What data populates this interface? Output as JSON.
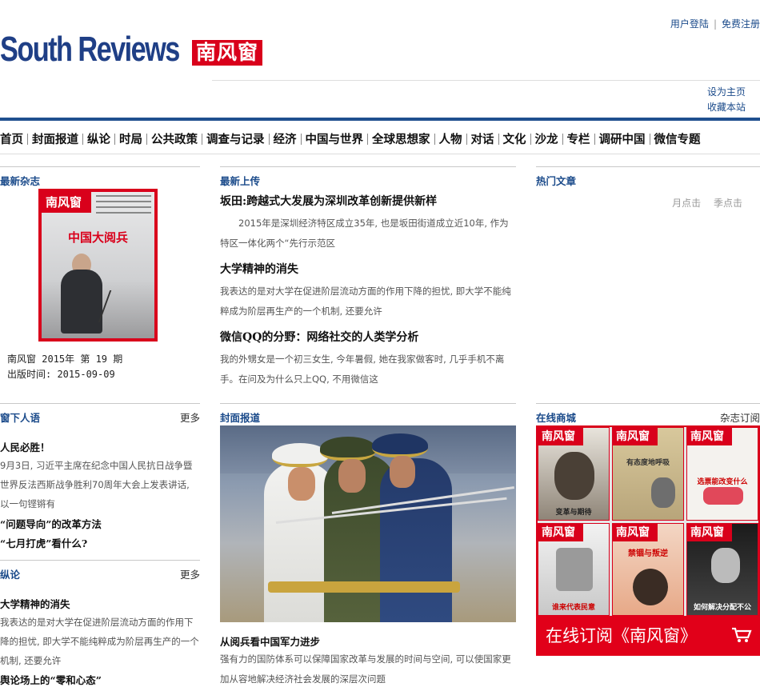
{
  "header": {
    "logo_en": "South Reviews",
    "logo_cn": "南风窗",
    "login": "用户登陆",
    "register": "免费注册",
    "set_home": "设为主页",
    "bookmark": "收藏本站"
  },
  "nav": [
    "首页",
    "封面报道",
    "纵论",
    "时局",
    "公共政策",
    "调查与记录",
    "经济",
    "中国与世界",
    "全球思想家",
    "人物",
    "对话",
    "文化",
    "沙龙",
    "专栏",
    "调研中国",
    "微信专题"
  ],
  "latest_magazine": {
    "title": "最新杂志",
    "cover_brand": "南风窗",
    "cover_headline": "中国大阅兵",
    "issue": "南风窗 2015年 第 19 期",
    "date": "出版时间: 2015-09-09"
  },
  "latest_upload": {
    "title": "最新上传",
    "articles": [
      {
        "title": "坂田:跨越式大发展为深圳改革创新提供新样",
        "summary": "　　2015年是深圳经济特区成立35年, 也是坂田街道成立近10年, 作为特区一体化两个“先行示范区"
      },
      {
        "title": "大学精神的消失",
        "summary": "我表达的是对大学在促进阶层流动方面的作用下降的担忧, 即大学不能纯粹成为阶层再生产的一个机制, 还要允许"
      },
      {
        "title": "微信QQ的分野：网络社交的人类学分析",
        "summary": "我的外甥女是一个初三女生, 今年暑假, 她在我家做客时, 几乎手机不离手。在问及为什么只上QQ, 不用微信这"
      }
    ]
  },
  "hot": {
    "title": "热门文章",
    "tab_month": "月点击",
    "tab_season": "季点击"
  },
  "window": {
    "title": "窗下人语",
    "more": "更多",
    "item1_title": "人民必胜！",
    "item1_text": "9月3日, 习近平主席在纪念中国人民抗日战争暨世界反法西斯战争胜利70周年大会上发表讲话, 以一句铿锵有",
    "item2_title": "“问题导向”的改革方法",
    "item3_title": "“七月打虎”看什么?"
  },
  "zonglun": {
    "title": "纵论",
    "more": "更多",
    "item1_title": "大学精神的消失",
    "item1_text": "我表达的是对大学在促进阶层流动方面的作用下降的担忧, 即大学不能纯粹成为阶层再生产的一个机制, 还要允许",
    "item2_title": "舆论场上的“零和心态”"
  },
  "cover_story": {
    "title": "封面报道",
    "headline": "从阅兵看中国军力进步",
    "summary": "强有力的国防体系可以保障国家改革与发展的时间与空间, 可以使国家更加从容地解决经济社会发展的深层次问题"
  },
  "shop": {
    "title": "在线商城",
    "subscribe": "杂志订阅",
    "banner": "在线订阅《南风窗》",
    "mag_brand": "南风窗",
    "covers": [
      "变革与期待",
      "有态度地呼吸",
      "选票能改变什么",
      "谁来代表民意",
      "禁锢与叛逆",
      "如何解决分配不公"
    ]
  },
  "colors": {
    "brand_red": "#d9001b",
    "brand_blue": "#1f3f86",
    "link_blue": "#1a4a8a"
  }
}
